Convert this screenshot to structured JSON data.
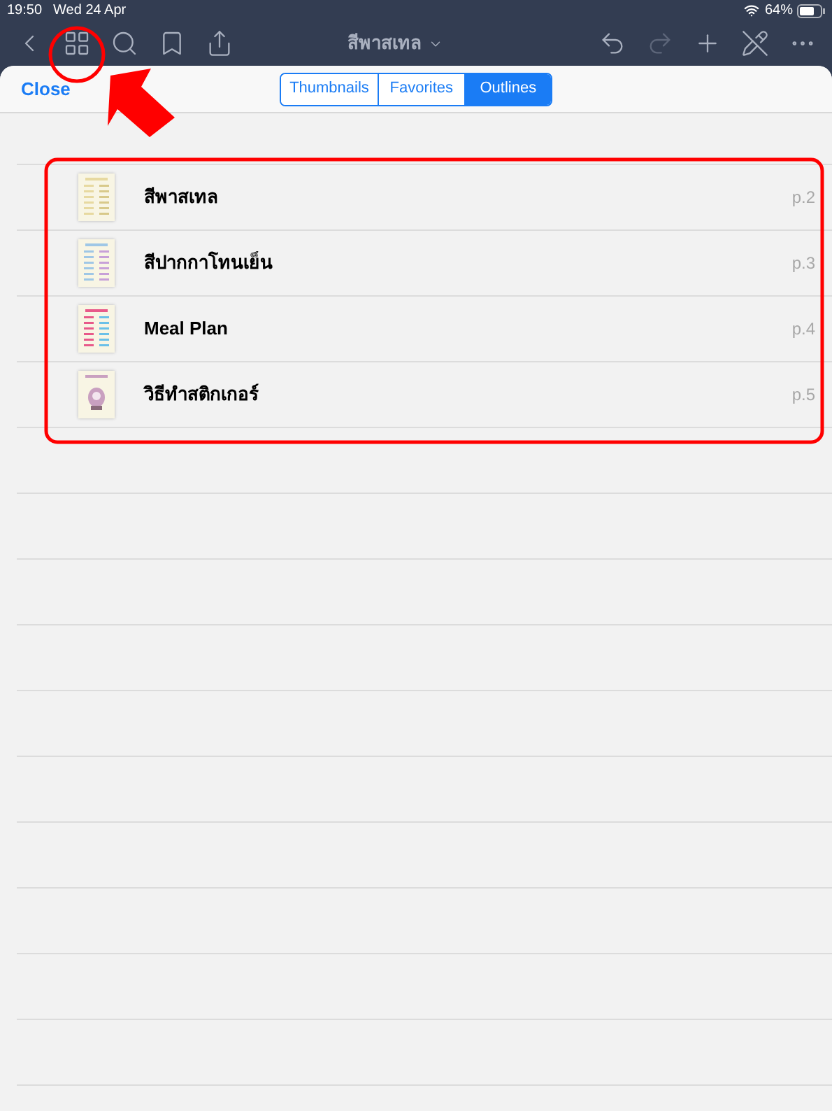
{
  "status_bar": {
    "time": "19:50",
    "date": "Wed 24 Apr",
    "battery": "64%"
  },
  "toolbar": {
    "left_buttons": [
      {
        "kind": "back",
        "disabled": false
      },
      {
        "kind": "grid",
        "disabled": false
      },
      {
        "kind": "search",
        "disabled": false
      },
      {
        "kind": "bookmark",
        "disabled": false
      },
      {
        "kind": "share",
        "disabled": false
      }
    ],
    "title": "สีพาสเทล",
    "right_buttons": [
      {
        "kind": "undo",
        "disabled": false
      },
      {
        "kind": "redo",
        "disabled": true
      },
      {
        "kind": "add",
        "disabled": false
      },
      {
        "kind": "pen-off",
        "disabled": false
      },
      {
        "kind": "more",
        "disabled": false
      }
    ]
  },
  "sheet": {
    "close": "Close",
    "tabs": [
      {
        "label": "Thumbnails",
        "selected": false
      },
      {
        "label": "Favorites",
        "selected": false
      },
      {
        "label": "Outlines",
        "selected": true
      }
    ],
    "outlines": [
      {
        "title": "สีพาสเทล",
        "page": "p.2"
      },
      {
        "title": "สีปากกาโทนเย็น",
        "page": "p.3"
      },
      {
        "title": "Meal Plan",
        "page": "p.4"
      },
      {
        "title": "วิธีทำสติกเกอร์",
        "page": "p.5"
      }
    ]
  }
}
